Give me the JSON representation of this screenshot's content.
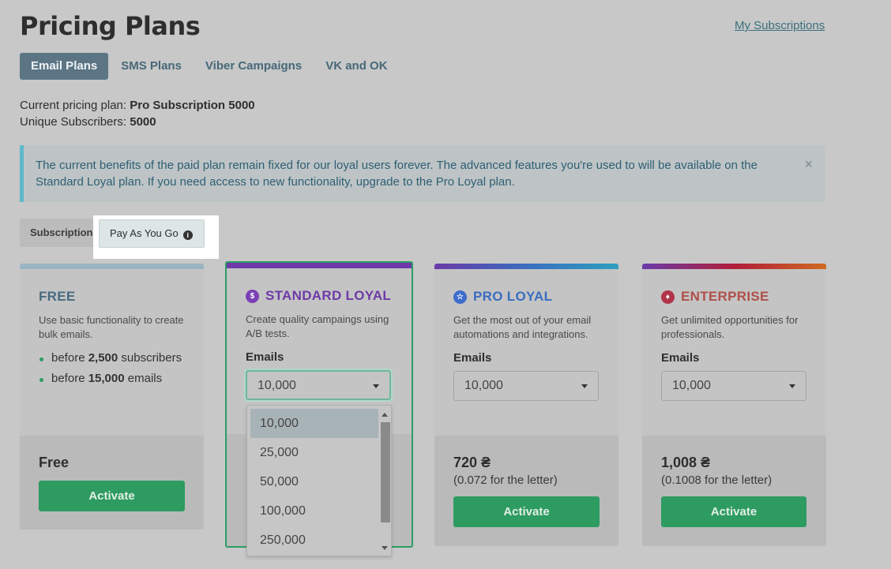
{
  "header": {
    "title": "Pricing Plans",
    "my_subscriptions": "My Subscriptions"
  },
  "top_tabs": [
    {
      "label": "Email Plans",
      "active": true
    },
    {
      "label": "SMS Plans",
      "active": false
    },
    {
      "label": "Viber Campaigns",
      "active": false
    },
    {
      "label": "VK and OK",
      "active": false
    }
  ],
  "plan_info": {
    "current_label": "Current pricing plan:",
    "current_value": "Pro Subscription 5000",
    "subscribers_label": "Unique Subscribers:",
    "subscribers_value": "5000"
  },
  "alert": {
    "text": "The current benefits of the paid plan remain fixed for our loyal users forever. The advanced features you're used to will be available on the Standard Loyal plan. If you need access to new functionality, upgrade to the Pro Loyal plan.",
    "close": "×"
  },
  "sub_tabs": {
    "subscription": "Subscription",
    "pay_as_you_go": "Pay As You Go",
    "info_icon": "i"
  },
  "cards": {
    "free": {
      "title": "FREE",
      "desc": "Use basic functionality to create bulk emails.",
      "items": [
        {
          "pre": "before ",
          "bold": "2,500",
          "post": " subscribers"
        },
        {
          "pre": "before ",
          "bold": "15,000",
          "post": " emails"
        }
      ],
      "price": "Free",
      "button": "Activate"
    },
    "standard": {
      "title": "STANDARD LOYAL",
      "icon": "$",
      "desc": "Create quality campaings using A/B tests.",
      "field_label": "Emails",
      "selected": "10,000"
    },
    "pro": {
      "title": "PRO LOYAL",
      "icon": "☆",
      "desc": "Get the most out of your email automations and integrations.",
      "field_label": "Emails",
      "selected": "10,000",
      "price": "720 ₴",
      "price_sub": "(0.072 for the letter)",
      "button": "Activate"
    },
    "enterprise": {
      "title": "ENTERPRISE",
      "icon": "♦",
      "desc": "Get unlimited opportunities for professionals.",
      "field_label": "Emails",
      "selected": "10,000",
      "price": "1,008 ₴",
      "price_sub": "(0.1008 for the letter)",
      "button": "Activate"
    }
  },
  "dropdown": {
    "options": [
      "10,000",
      "25,000",
      "50,000",
      "100,000",
      "250,000"
    ],
    "selected_index": 0
  },
  "colors": {
    "accent_green": "#2e9b61",
    "free_bar": "#9ab4c4",
    "standard_purple": "#6e3aa8",
    "pro_blue": "#3a6dc0",
    "enterprise_red": "#b0504a"
  }
}
